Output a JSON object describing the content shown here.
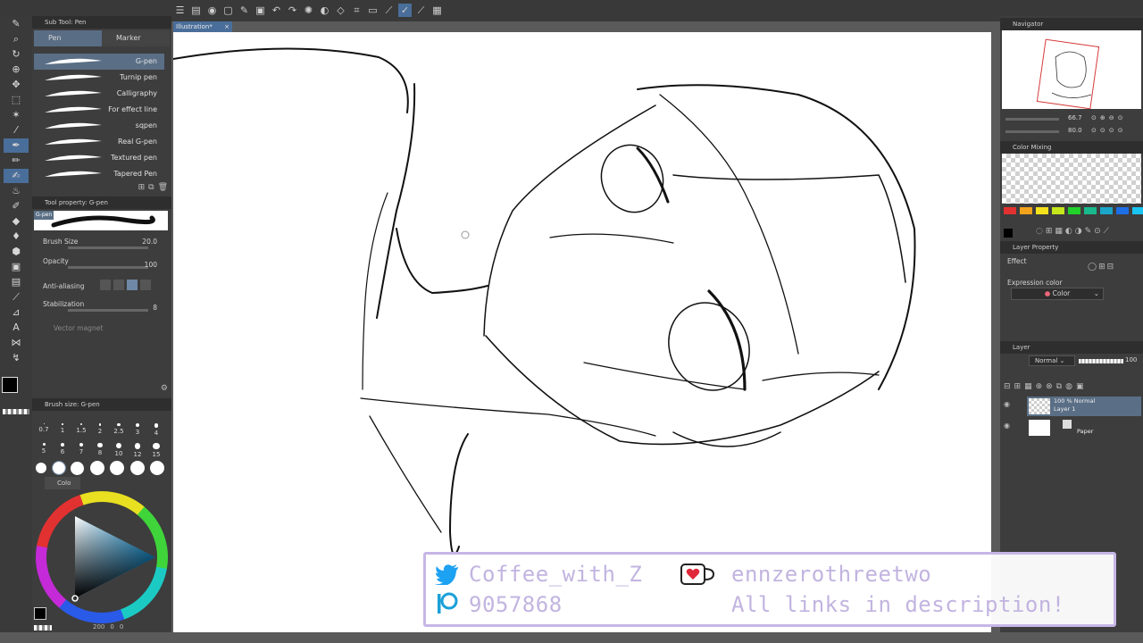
{
  "toolbar": {
    "icons": [
      "menu-icon",
      "brush-list-icon",
      "hide-icon",
      "new-icon",
      "open-icon",
      "save-icon",
      "undo-icon",
      "redo-icon",
      "spinner-icon",
      "fill-icon",
      "transform-icon",
      "crop-icon",
      "snap-icon",
      "ruler-icon",
      "pen-active-icon",
      "line-icon",
      "border-icon"
    ]
  },
  "canvas_tab": {
    "label": "Illustration*"
  },
  "subtool": {
    "header": "Sub Tool: Pen",
    "tabs": [
      {
        "label": "Pen"
      },
      {
        "label": "Marker"
      }
    ],
    "brushes": [
      "G-pen",
      "Turnip pen",
      "Calligraphy",
      "For effect line",
      "sqpen",
      "Real G-pen",
      "Textured pen",
      "Tapered Pen"
    ]
  },
  "toolprop": {
    "header": "Tool property: G-pen",
    "preview_label": "G-pen",
    "brush_size_label": "Brush Size",
    "brush_size": "20.0",
    "opacity_label": "Opacity",
    "opacity": "100",
    "antialias_label": "Anti-aliasing",
    "stabilization_label": "Stabilization",
    "stabilization": "8",
    "vector_magnet_label": "Vector magnet"
  },
  "brushsize": {
    "header": "Brush size: G-pen",
    "sizes_row1": [
      "0.7",
      "1",
      "1.5",
      "2",
      "2.5",
      "3",
      "4"
    ],
    "sizes_row2": [
      "5",
      "6",
      "7",
      "8",
      "10",
      "12",
      "15"
    ]
  },
  "color": {
    "header": "Colo",
    "footer": "200",
    "footer2": "0",
    "footer3": "0"
  },
  "navigator": {
    "header": "Navigator",
    "zoom": "66.7",
    "rotate": "80.0"
  },
  "color_mixing": {
    "header": "Color Mixing",
    "palette": [
      "#e23131",
      "#f2a21c",
      "#f5e21c",
      "#c6e61c",
      "#22d02a",
      "#19b98c",
      "#1aa6c8",
      "#1e6ee6",
      "#1ac4f0"
    ]
  },
  "layer_property": {
    "header": "Layer Property",
    "effect_label": "Effect",
    "expression_label": "Expression color",
    "expression_value": "Color"
  },
  "layer": {
    "header": "Layer",
    "blend": "Normal",
    "opacity": "100",
    "items": [
      {
        "line1": "100 % Normal",
        "line2": "Layer 1"
      },
      {
        "line1": "",
        "line2": "Paper"
      }
    ]
  },
  "overlay": {
    "twitter": "Coffee_with_Z",
    "kofi": "ennzerothreetwo",
    "patreon": "9057868",
    "links": "All links in description!"
  }
}
